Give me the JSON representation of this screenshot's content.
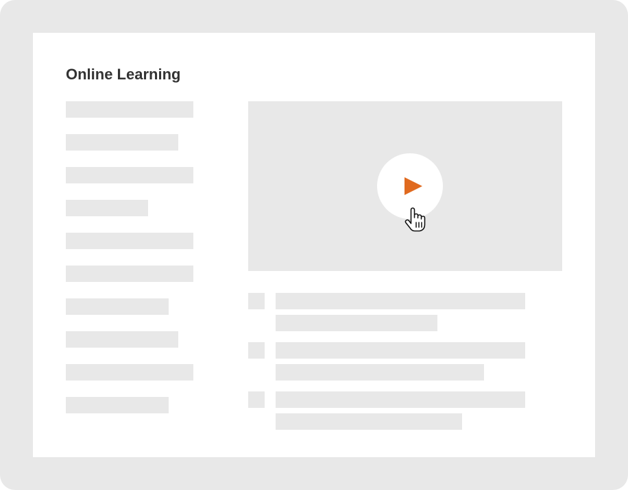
{
  "page": {
    "title": "Online Learning"
  },
  "colors": {
    "frame": "#e8e8e8",
    "placeholder": "#e8e8e8",
    "background": "#ffffff",
    "title_text": "#333333",
    "play_accent": "#e06a1f"
  },
  "icons": {
    "play": "play-icon",
    "cursor": "hand-pointer-icon"
  },
  "sidebar": {
    "items": [
      "",
      "",
      "",
      "",
      "",
      "",
      "",
      "",
      "",
      ""
    ]
  },
  "main": {
    "video": {
      "state": "paused"
    },
    "lessons": [
      "",
      "",
      ""
    ]
  }
}
